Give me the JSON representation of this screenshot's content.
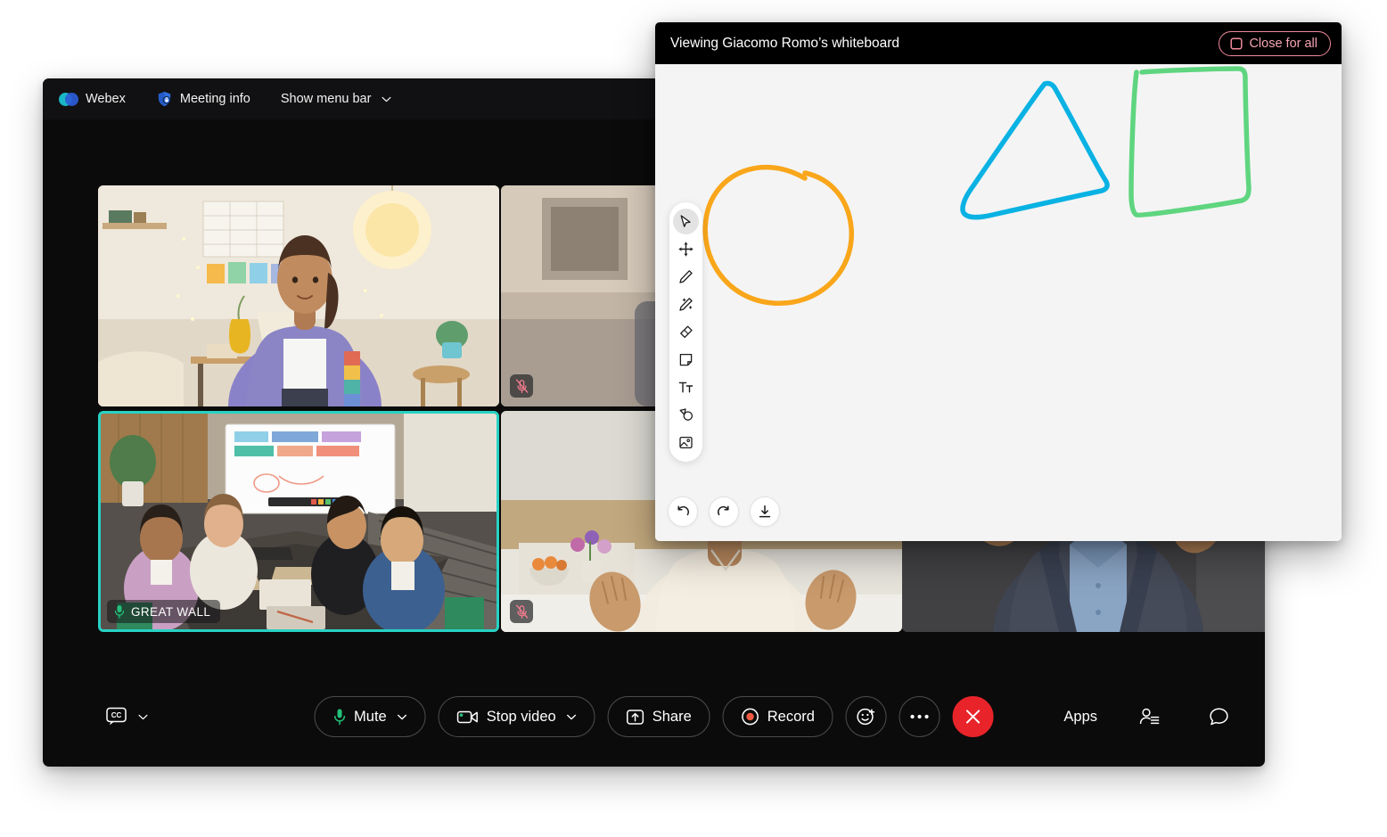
{
  "app": {
    "name": "Webex",
    "topbar": {
      "logo_label": "Webex",
      "meeting_info_label": "Meeting info",
      "menu_bar_label": "Show menu bar"
    }
  },
  "video_grid": {
    "tiles": [
      {
        "id": "tile-1",
        "label": "",
        "muted": false,
        "active_speaker": false
      },
      {
        "id": "tile-2",
        "label": "",
        "muted": true,
        "active_speaker": false
      },
      {
        "id": "tile-3",
        "label": "GREAT WALL",
        "muted": false,
        "active_speaker": true
      },
      {
        "id": "tile-4",
        "label": "",
        "muted": true,
        "active_speaker": false
      },
      {
        "id": "tile-5",
        "label": "",
        "muted": false,
        "active_speaker": false
      }
    ]
  },
  "controls": {
    "closed_captions": "CC",
    "mute_label": "Mute",
    "stop_video_label": "Stop video",
    "share_label": "Share",
    "record_label": "Record",
    "reactions_label": "",
    "more_label": "···",
    "leave_label": "",
    "apps_label": "Apps",
    "participants_label": "",
    "chat_label": ""
  },
  "whiteboard": {
    "title": "Viewing Giacomo Romo’s whiteboard",
    "close_for_all_label": "Close for all",
    "tools": [
      {
        "name": "select-tool",
        "active": true
      },
      {
        "name": "move-tool",
        "active": false
      },
      {
        "name": "pen-tool",
        "active": false
      },
      {
        "name": "magic-pen-tool",
        "active": false
      },
      {
        "name": "eraser-tool",
        "active": false
      },
      {
        "name": "sticky-note-tool",
        "active": false
      },
      {
        "name": "text-tool",
        "active": false
      },
      {
        "name": "shapes-tool",
        "active": false
      },
      {
        "name": "image-tool",
        "active": false
      }
    ],
    "actions": [
      {
        "name": "undo-button"
      },
      {
        "name": "redo-button"
      },
      {
        "name": "download-button"
      }
    ],
    "drawings": [
      {
        "shape": "circle",
        "color": "#f9a61a"
      },
      {
        "shape": "triangle",
        "color": "#09b2e3"
      },
      {
        "shape": "square",
        "color": "#5fd57f"
      }
    ]
  },
  "colors": {
    "accent_teal": "#27d2c4",
    "danger_red": "#e8242a",
    "record_red": "#f05a41",
    "mic_green": "#22c07a",
    "close_pink": "#f6a3b1",
    "window_bg": "#0b0b0b",
    "whiteboard_bg": "#f4f4f5"
  }
}
